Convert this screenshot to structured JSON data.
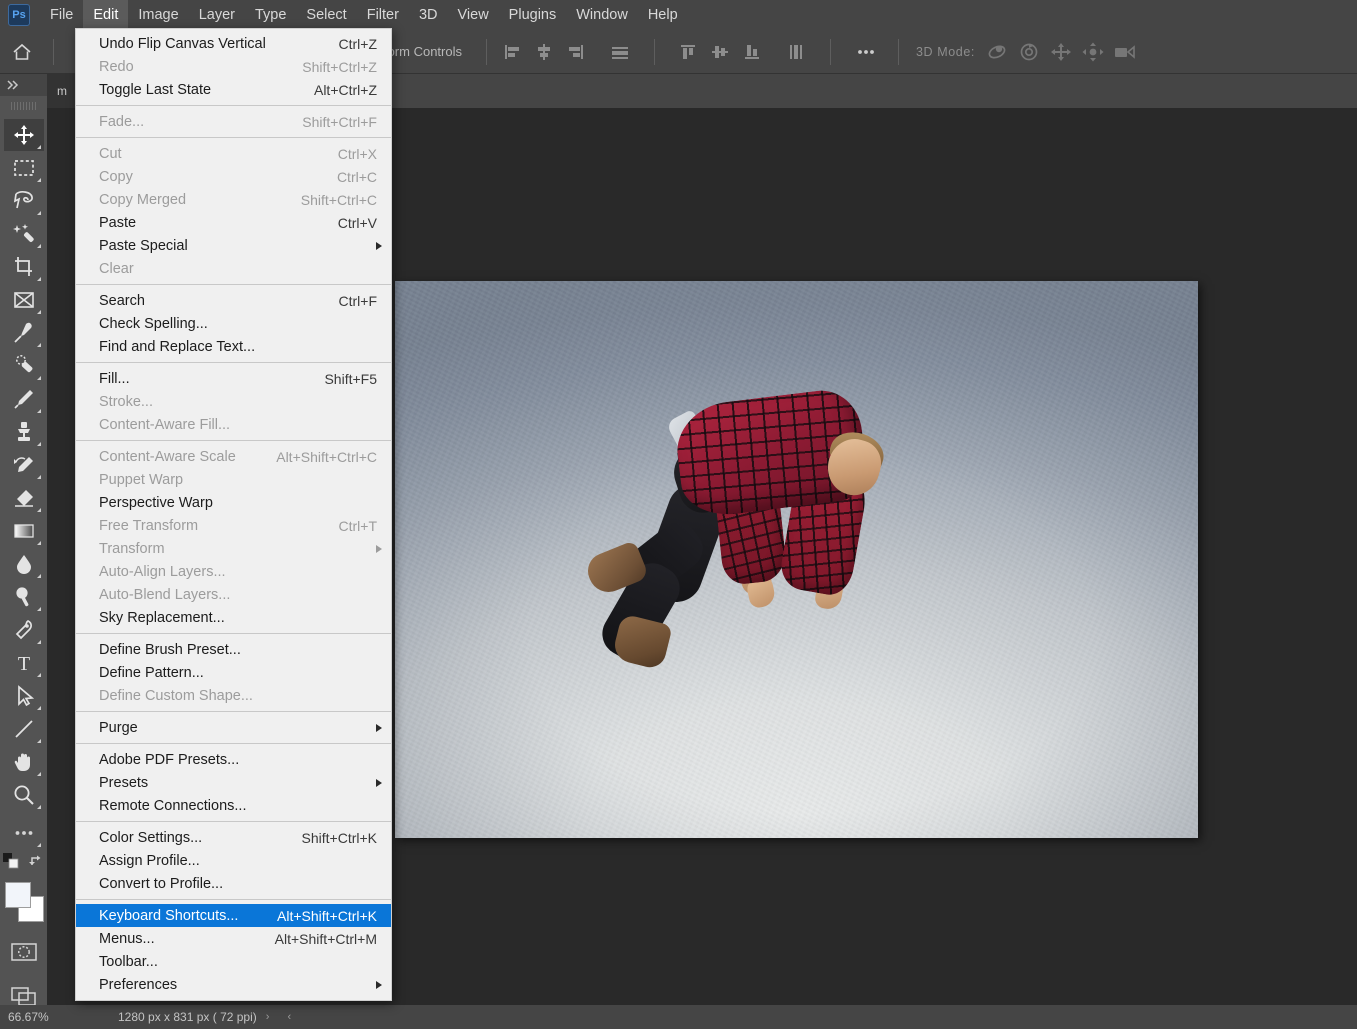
{
  "app": {
    "logo_text": "Ps",
    "menubar": [
      {
        "label": "File",
        "active": false
      },
      {
        "label": "Edit",
        "active": true
      },
      {
        "label": "Image",
        "active": false
      },
      {
        "label": "Layer",
        "active": false
      },
      {
        "label": "Type",
        "active": false
      },
      {
        "label": "Select",
        "active": false
      },
      {
        "label": "Filter",
        "active": false
      },
      {
        "label": "3D",
        "active": false
      },
      {
        "label": "View",
        "active": false
      },
      {
        "label": "Plugins",
        "active": false
      },
      {
        "label": "Window",
        "active": false
      },
      {
        "label": "Help",
        "active": false
      }
    ]
  },
  "options_bar": {
    "home_icon": "home-icon",
    "transform_controls_label": "ansform Controls",
    "align_icons": [
      "align-left-edges-icon",
      "align-horizontal-centers-icon",
      "align-right-edges-icon",
      "distribute-horizontally-icon"
    ],
    "align_icons_2": [
      "align-top-edges-icon",
      "align-vertical-centers-icon",
      "align-bottom-edges-icon",
      "distribute-vertically-icon"
    ],
    "more_icon": "ellipsis-icon",
    "three_d_label": "3D Mode:",
    "three_d_icons": [
      "orbit-3d-icon",
      "roll-3d-icon",
      "pan-3d-icon",
      "slide-3d-icon",
      "camera-3d-icon"
    ]
  },
  "toolbar": {
    "expand_icon": "double-chevron-right-icon",
    "tools": [
      {
        "name": "move-tool",
        "selected": true
      },
      {
        "name": "rectangular-marquee-tool",
        "selected": false
      },
      {
        "name": "lasso-tool",
        "selected": false
      },
      {
        "name": "object-selection-tool",
        "selected": false
      },
      {
        "name": "crop-tool",
        "selected": false
      },
      {
        "name": "frame-tool",
        "selected": false
      },
      {
        "name": "eyedropper-tool",
        "selected": false
      },
      {
        "name": "spot-healing-brush-tool",
        "selected": false
      },
      {
        "name": "brush-tool",
        "selected": false
      },
      {
        "name": "clone-stamp-tool",
        "selected": false
      },
      {
        "name": "history-brush-tool",
        "selected": false
      },
      {
        "name": "eraser-tool",
        "selected": false
      },
      {
        "name": "gradient-tool",
        "selected": false
      },
      {
        "name": "blur-tool",
        "selected": false
      },
      {
        "name": "dodge-tool",
        "selected": false
      },
      {
        "name": "pen-tool",
        "selected": false
      },
      {
        "name": "horizontal-type-tool",
        "selected": false
      },
      {
        "name": "path-selection-tool",
        "selected": false
      },
      {
        "name": "line-shape-tool",
        "selected": false
      },
      {
        "name": "hand-tool",
        "selected": false
      },
      {
        "name": "zoom-tool",
        "selected": false
      },
      {
        "name": "edit-toolbar-tool",
        "selected": false
      }
    ],
    "default_colors_icon": "default-foreground-background-icon",
    "swap_colors_icon": "swap-foreground-background-icon",
    "foreground_color": "#f2f5fa",
    "background_color": "#ffffff",
    "quick_mask_icon": "quick-mask-mode-icon",
    "screen_mode_icon": "change-screen-mode-icon"
  },
  "document": {
    "tab_label": "m"
  },
  "status_bar": {
    "zoom_level": "66.67%",
    "doc_dimensions": "1280 px x 831 px ( 72 ppi)",
    "next_arrow": "›",
    "prev_arrow": "‹"
  },
  "edit_menu": {
    "items": [
      {
        "label": "Undo Flip Canvas Vertical",
        "accel": "Ctrl+Z",
        "disabled": false,
        "submenu": false,
        "highlight": false
      },
      {
        "label": "Redo",
        "accel": "Shift+Ctrl+Z",
        "disabled": true,
        "submenu": false,
        "highlight": false
      },
      {
        "label": "Toggle Last State",
        "accel": "Alt+Ctrl+Z",
        "disabled": false,
        "submenu": false,
        "highlight": false
      },
      {
        "separator": true
      },
      {
        "label": "Fade...",
        "accel": "Shift+Ctrl+F",
        "disabled": true,
        "submenu": false,
        "highlight": false
      },
      {
        "separator": true
      },
      {
        "label": "Cut",
        "accel": "Ctrl+X",
        "disabled": true,
        "submenu": false,
        "highlight": false
      },
      {
        "label": "Copy",
        "accel": "Ctrl+C",
        "disabled": true,
        "submenu": false,
        "highlight": false
      },
      {
        "label": "Copy Merged",
        "accel": "Shift+Ctrl+C",
        "disabled": true,
        "submenu": false,
        "highlight": false
      },
      {
        "label": "Paste",
        "accel": "Ctrl+V",
        "disabled": false,
        "submenu": false,
        "highlight": false
      },
      {
        "label": "Paste Special",
        "accel": "",
        "disabled": false,
        "submenu": true,
        "highlight": false
      },
      {
        "label": "Clear",
        "accel": "",
        "disabled": true,
        "submenu": false,
        "highlight": false
      },
      {
        "separator": true
      },
      {
        "label": "Search",
        "accel": "Ctrl+F",
        "disabled": false,
        "submenu": false,
        "highlight": false
      },
      {
        "label": "Check Spelling...",
        "accel": "",
        "disabled": false,
        "submenu": false,
        "highlight": false
      },
      {
        "label": "Find and Replace Text...",
        "accel": "",
        "disabled": false,
        "submenu": false,
        "highlight": false
      },
      {
        "separator": true
      },
      {
        "label": "Fill...",
        "accel": "Shift+F5",
        "disabled": false,
        "submenu": false,
        "highlight": false
      },
      {
        "label": "Stroke...",
        "accel": "",
        "disabled": true,
        "submenu": false,
        "highlight": false
      },
      {
        "label": "Content-Aware Fill...",
        "accel": "",
        "disabled": true,
        "submenu": false,
        "highlight": false
      },
      {
        "separator": true
      },
      {
        "label": "Content-Aware Scale",
        "accel": "Alt+Shift+Ctrl+C",
        "disabled": true,
        "submenu": false,
        "highlight": false
      },
      {
        "label": "Puppet Warp",
        "accel": "",
        "disabled": true,
        "submenu": false,
        "highlight": false
      },
      {
        "label": "Perspective Warp",
        "accel": "",
        "disabled": false,
        "submenu": false,
        "highlight": false
      },
      {
        "label": "Free Transform",
        "accel": "Ctrl+T",
        "disabled": true,
        "submenu": false,
        "highlight": false
      },
      {
        "label": "Transform",
        "accel": "",
        "disabled": true,
        "submenu": true,
        "highlight": false
      },
      {
        "label": "Auto-Align Layers...",
        "accel": "",
        "disabled": true,
        "submenu": false,
        "highlight": false
      },
      {
        "label": "Auto-Blend Layers...",
        "accel": "",
        "disabled": true,
        "submenu": false,
        "highlight": false
      },
      {
        "label": "Sky Replacement...",
        "accel": "",
        "disabled": false,
        "submenu": false,
        "highlight": false
      },
      {
        "separator": true
      },
      {
        "label": "Define Brush Preset...",
        "accel": "",
        "disabled": false,
        "submenu": false,
        "highlight": false
      },
      {
        "label": "Define Pattern...",
        "accel": "",
        "disabled": false,
        "submenu": false,
        "highlight": false
      },
      {
        "label": "Define Custom Shape...",
        "accel": "",
        "disabled": true,
        "submenu": false,
        "highlight": false
      },
      {
        "separator": true
      },
      {
        "label": "Purge",
        "accel": "",
        "disabled": false,
        "submenu": true,
        "highlight": false
      },
      {
        "separator": true
      },
      {
        "label": "Adobe PDF Presets...",
        "accel": "",
        "disabled": false,
        "submenu": false,
        "highlight": false
      },
      {
        "label": "Presets",
        "accel": "",
        "disabled": false,
        "submenu": true,
        "highlight": false
      },
      {
        "label": "Remote Connections...",
        "accel": "",
        "disabled": false,
        "submenu": false,
        "highlight": false
      },
      {
        "separator": true
      },
      {
        "label": "Color Settings...",
        "accel": "Shift+Ctrl+K",
        "disabled": false,
        "submenu": false,
        "highlight": false
      },
      {
        "label": "Assign Profile...",
        "accel": "",
        "disabled": false,
        "submenu": false,
        "highlight": false
      },
      {
        "label": "Convert to Profile...",
        "accel": "",
        "disabled": false,
        "submenu": false,
        "highlight": false
      },
      {
        "separator": true
      },
      {
        "label": "Keyboard Shortcuts...",
        "accel": "Alt+Shift+Ctrl+K",
        "disabled": false,
        "submenu": false,
        "highlight": true
      },
      {
        "label": "Menus...",
        "accel": "Alt+Shift+Ctrl+M",
        "disabled": false,
        "submenu": false,
        "highlight": false
      },
      {
        "label": "Toolbar...",
        "accel": "",
        "disabled": false,
        "submenu": false,
        "highlight": false
      },
      {
        "label": "Preferences",
        "accel": "",
        "disabled": false,
        "submenu": true,
        "highlight": false
      }
    ]
  },
  "canvas": {
    "image_description": "man-floating-in-air-photo",
    "accent_highlight": "#0a76d8"
  }
}
